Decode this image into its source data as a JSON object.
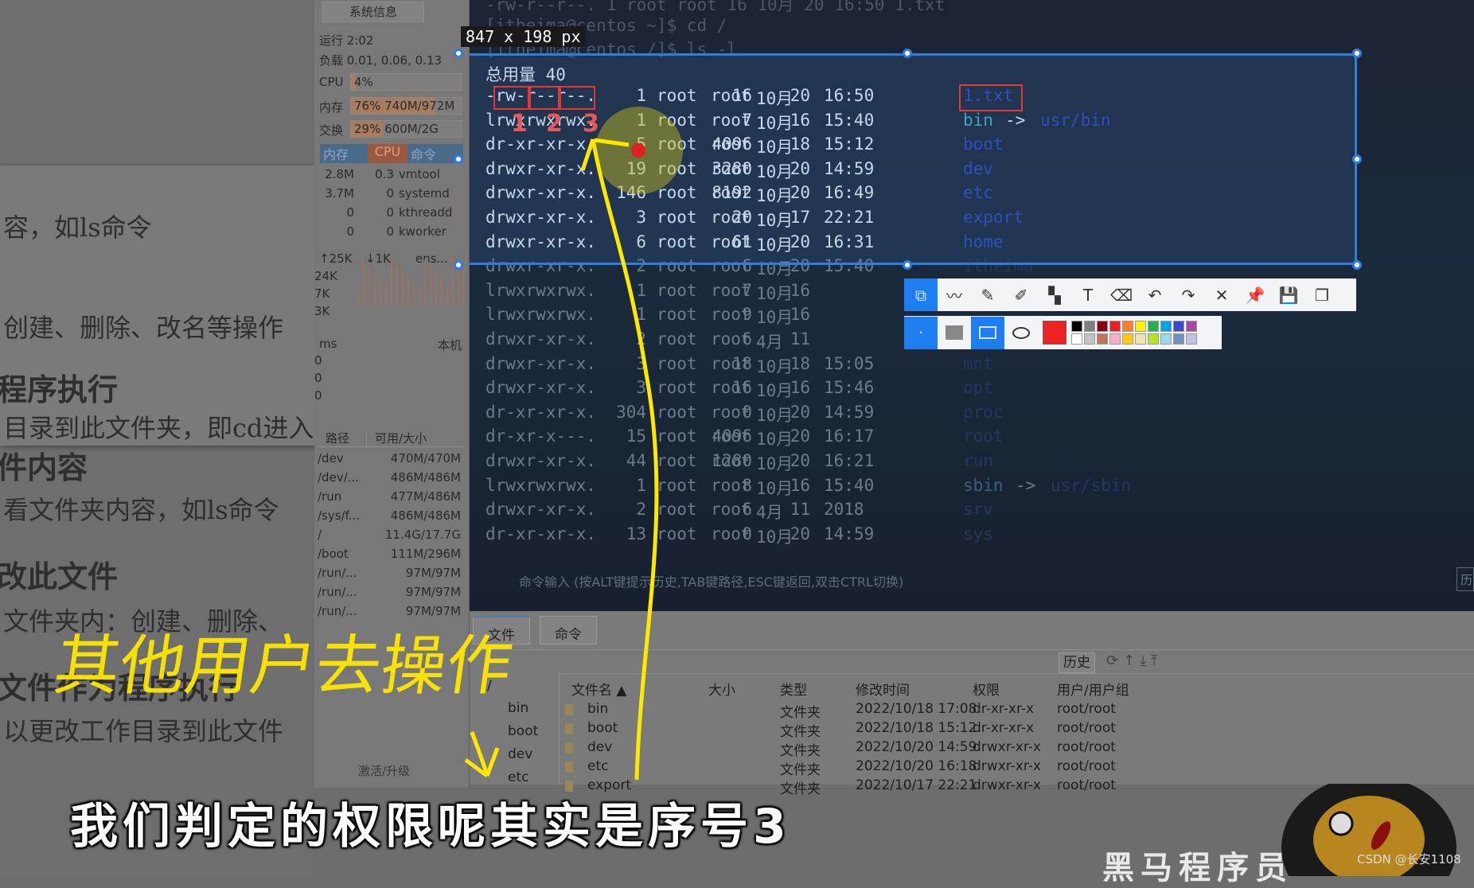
{
  "doc": {
    "lines": [
      {
        "t": "容，如ls命令",
        "h": false
      },
      {
        "t": "创建、删除、改名等操作",
        "h": false
      },
      {
        "t": "程序执行",
        "h": true
      },
      {
        "t": "目录到此文件夹，即cd进入",
        "h": false
      },
      {
        "t": "件内容",
        "h": true
      },
      {
        "t": "看文件夹内容，如ls命令",
        "h": false
      },
      {
        "t": "改此文件",
        "h": true
      },
      {
        "t": "文件夹内：创建、删除、",
        "h": false
      },
      {
        "t": "文件作为程序执行",
        "h": true
      },
      {
        "t": "以更改工作目录到此文件",
        "h": false
      }
    ]
  },
  "sidebar": {
    "sysinfo_button": "系统信息",
    "uptime": "运行 2:02",
    "load": "负载 0.01, 0.06, 0.13",
    "cpu": {
      "label": "CPU",
      "text": "4%",
      "percent": 4
    },
    "mem": {
      "label": "内存",
      "text": "76% 740M/972M",
      "percent": 76
    },
    "swap": {
      "label": "交换",
      "text": "29%   600M/2G",
      "percent": 29
    },
    "proc_tabs": [
      "内存",
      "CPU",
      "命令"
    ],
    "procs": [
      [
        "2.8M",
        "0.3",
        "vmtool"
      ],
      [
        "3.7M",
        "0",
        "systemd"
      ],
      [
        "0",
        "0",
        "kthreadd"
      ],
      [
        "0",
        "0",
        "kworker"
      ]
    ],
    "net": {
      "up": "↑25K",
      "down": "↓1K",
      "iface": "ens...",
      "scale": [
        "24K",
        "7K",
        "3K"
      ]
    },
    "ping": {
      "label": "ms",
      "host": "本机",
      "scale": [
        "0",
        "0",
        "0"
      ]
    },
    "disk_headers": [
      "路径",
      "可用/大小"
    ],
    "disks": [
      [
        "/dev",
        "470M/470M"
      ],
      [
        "/dev/...",
        "486M/486M"
      ],
      [
        "/run",
        "477M/486M"
      ],
      [
        "/sys/f...",
        "486M/486M"
      ],
      [
        "/",
        "11.4G/17.7G"
      ],
      [
        "/boot",
        "111M/296M"
      ],
      [
        "/run/...",
        "97M/97M"
      ],
      [
        "/run/...",
        "97M/97M"
      ],
      [
        "/run/...",
        "97M/97M"
      ]
    ],
    "activate": "激活/升级"
  },
  "terminal": {
    "pre_lines": [
      "-rw-r--r--.   1 root root   16 10月  20 16:50 1.txt",
      "[itheima@centos ~]$ cd /",
      "[itheima@centos /]$ ls -l"
    ],
    "total": "总用量 40",
    "rows": [
      [
        "-rw-r--r--.",
        "1",
        "root",
        "root",
        "16",
        "10月",
        "20",
        "16:50",
        "1.txt",
        ""
      ],
      [
        "lrwxrwxrwx.",
        "1",
        "root",
        "root",
        "7",
        "10月",
        "16",
        "15:40",
        "bin",
        "usr/bin"
      ],
      [
        "dr-xr-xr-x.",
        "5",
        "root",
        "root",
        "4096",
        "10月",
        "18",
        "15:12",
        "boot",
        ""
      ],
      [
        "drwxr-xr-x.",
        "19",
        "root",
        "root",
        "3280",
        "10月",
        "20",
        "14:59",
        "dev",
        ""
      ],
      [
        "drwxr-xr-x.",
        "146",
        "root",
        "root",
        "8192",
        "10月",
        "20",
        "16:49",
        "etc",
        ""
      ],
      [
        "drwxr-xr-x.",
        "3",
        "root",
        "root",
        "20",
        "10月",
        "17",
        "22:21",
        "export",
        ""
      ],
      [
        "drwxr-xr-x.",
        "6",
        "root",
        "root",
        "61",
        "10月",
        "20",
        "16:31",
        "home",
        ""
      ],
      [
        "drwxr-xr-x.",
        "2",
        "root",
        "root",
        "6",
        "10月",
        "20",
        "15:40",
        "itheima",
        ""
      ],
      [
        "lrwxrwxrwx.",
        "1",
        "root",
        "root",
        "7",
        "10月",
        "16",
        "",
        "",
        ""
      ],
      [
        "lrwxrwxrwx.",
        "1",
        "root",
        "root",
        "9",
        "10月",
        "16",
        "",
        "",
        ""
      ],
      [
        "drwxr-xr-x.",
        "2",
        "root",
        "root",
        "6",
        "4月",
        "11",
        "",
        "",
        ""
      ],
      [
        "drwxr-xr-x.",
        "3",
        "root",
        "root",
        "18",
        "10月",
        "18",
        "15:05",
        "mnt",
        ""
      ],
      [
        "drwxr-xr-x.",
        "3",
        "root",
        "root",
        "16",
        "10月",
        "16",
        "15:46",
        "opt",
        ""
      ],
      [
        "dr-xr-xr-x.",
        "304",
        "root",
        "root",
        "0",
        "10月",
        "20",
        "14:59",
        "proc",
        ""
      ],
      [
        "dr-xr-x---.",
        "15",
        "root",
        "root",
        "4096",
        "10月",
        "20",
        "16:17",
        "root",
        ""
      ],
      [
        "drwxr-xr-x.",
        "44",
        "root",
        "root",
        "1280",
        "10月",
        "20",
        "16:21",
        "run",
        ""
      ],
      [
        "lrwxrwxrwx.",
        "1",
        "root",
        "root",
        "8",
        "10月",
        "16",
        "15:40",
        "sbin",
        "usr/sbin"
      ],
      [
        "drwxr-xr-x.",
        "2",
        "root",
        "root",
        "6",
        "4月",
        "11",
        "2018",
        "srv",
        ""
      ],
      [
        "dr-xr-xr-x.",
        "13",
        "root",
        "root",
        "0",
        "10月",
        "20",
        "14:59",
        "sys",
        ""
      ]
    ],
    "cmd_placeholder": "命令输入 (按ALT键提示历史,TAB键路径,ESC键返回,双击CTRL切换)",
    "history_btn": "历"
  },
  "capture": {
    "size_label": "847 x 198  px",
    "numbers": [
      "1",
      "2",
      "3"
    ],
    "tools": [
      "shape",
      "polyline",
      "pen",
      "marker",
      "mosaic",
      "text",
      "eraser",
      "undo",
      "redo",
      "close",
      "pin",
      "save",
      "copy"
    ],
    "palette": [
      "#000000",
      "#7f7f7f",
      "#880015",
      "#ed1c24",
      "#ff7f27",
      "#fff200",
      "#22b14c",
      "#00a2e8",
      "#3f48cc",
      "#a349a4",
      "#ffffff",
      "#c3c3c3",
      "#b97a57",
      "#ffaec9",
      "#ffc90e",
      "#efe4b0",
      "#b5e61d",
      "#99d9ea",
      "#7092be",
      "#c8bfe7"
    ],
    "current_color": "#ee2222"
  },
  "files": {
    "tabs": [
      "文件",
      "命令"
    ],
    "history_btn": "历史",
    "tree_root": "/",
    "tree": [
      "bin",
      "boot",
      "dev",
      "etc"
    ],
    "headers": [
      "文件名 ▲",
      "大小",
      "类型",
      "修改时间",
      "权限",
      "用户/用户组"
    ],
    "rows": [
      [
        "bin",
        "",
        "文件夹",
        "2022/10/18 17:08",
        "dr-xr-xr-x",
        "root/root"
      ],
      [
        "boot",
        "",
        "文件夹",
        "2022/10/18 15:12",
        "dr-xr-xr-x",
        "root/root"
      ],
      [
        "dev",
        "",
        "文件夹",
        "2022/10/20 14:59",
        "drwxr-xr-x",
        "root/root"
      ],
      [
        "etc",
        "",
        "文件夹",
        "2022/10/20 16:18",
        "drwxr-xr-x",
        "root/root"
      ],
      [
        "export",
        "",
        "文件夹",
        "2022/10/17 22:21",
        "drwxr-xr-x",
        "root/root"
      ]
    ]
  },
  "annotation": {
    "handwriting": "其他用户去操作",
    "color": "#ffe800"
  },
  "subtitle": "我们判定的权限呢其实是序号3",
  "brand": "黑马程序员",
  "watermark": "CSDN @长安1108"
}
